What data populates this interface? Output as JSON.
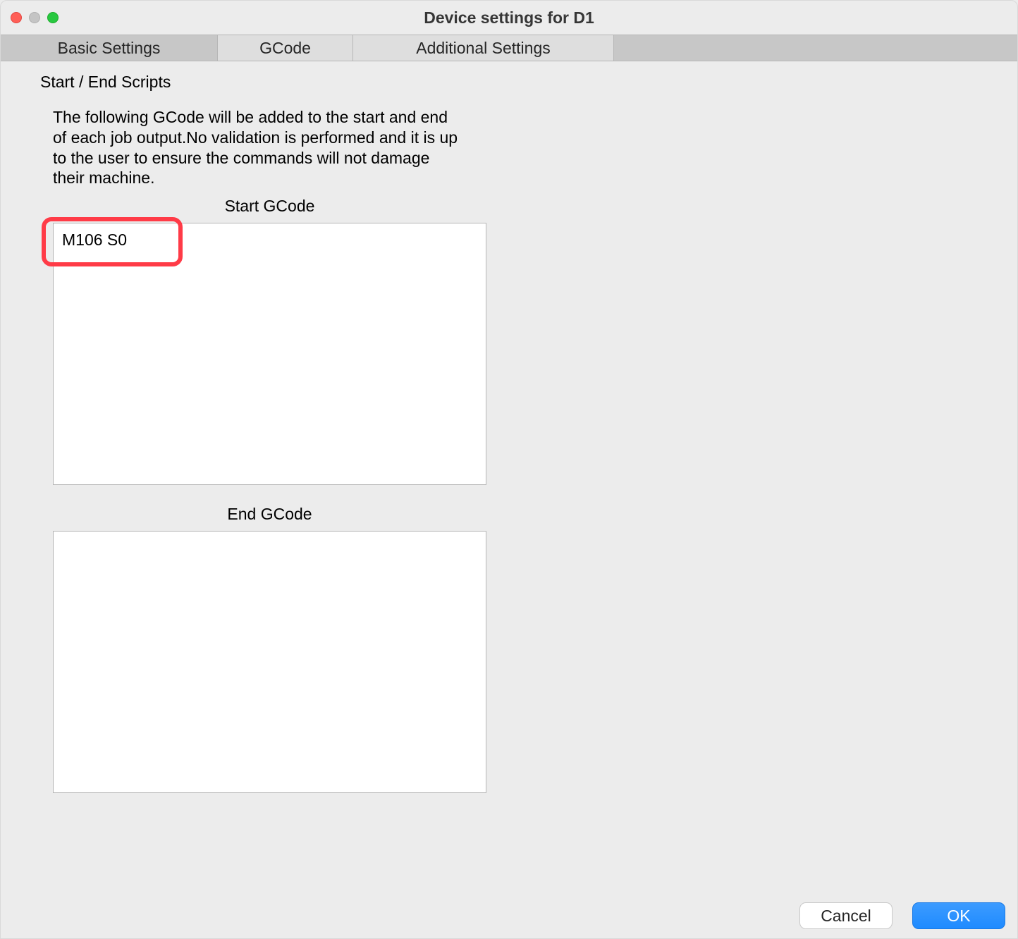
{
  "window": {
    "title": "Device settings for D1"
  },
  "tabs": {
    "basic": "Basic Settings",
    "gcode": "GCode",
    "additional": "Additional Settings"
  },
  "section": {
    "heading": "Start / End Scripts",
    "description": "The following GCode will be added to the start and end of each job output.No validation is performed and it is up to the user to ensure the commands will not damage their machine.",
    "start_label": "Start GCode",
    "end_label": "End GCode",
    "start_value": "M106 S0",
    "end_value": ""
  },
  "buttons": {
    "cancel": "Cancel",
    "ok": "OK"
  }
}
